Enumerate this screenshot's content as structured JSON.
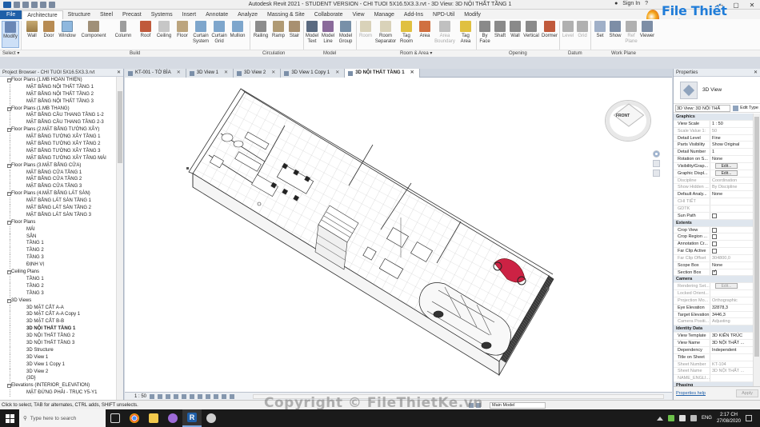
{
  "window": {
    "title": "Autodesk Revit 2021 - STUDENT VERSION - CHI TUOI 5X16.5X3.3.rvt - 3D View: 3D NỘI THẤT TẦNG 1",
    "sign_in": "Sign In",
    "help": "?"
  },
  "ribbon_tabs": [
    "File",
    "Architecture",
    "Structure",
    "Steel",
    "Precast",
    "Systems",
    "Insert",
    "Annotate",
    "Analyze",
    "Massing & Site",
    "Collaborate",
    "View",
    "Manage",
    "Add-Ins",
    "NPD-Util",
    "Modify"
  ],
  "ribbon": {
    "buttons": [
      {
        "id": "modify",
        "label": "Modify"
      },
      {
        "id": "wall",
        "label": "Wall"
      },
      {
        "id": "door",
        "label": "Door"
      },
      {
        "id": "window",
        "label": "Window"
      },
      {
        "id": "component",
        "label": "Component"
      },
      {
        "id": "column",
        "label": "Column"
      },
      {
        "id": "roof",
        "label": "Roof"
      },
      {
        "id": "ceiling",
        "label": "Ceiling"
      },
      {
        "id": "floor",
        "label": "Floor"
      },
      {
        "id": "curtain_system",
        "label": "Curtain\nSystem"
      },
      {
        "id": "curtain_grid",
        "label": "Curtain\nGrid"
      },
      {
        "id": "mullion",
        "label": "Mullion"
      },
      {
        "id": "railing",
        "label": "Railing"
      },
      {
        "id": "ramp",
        "label": "Ramp"
      },
      {
        "id": "stair",
        "label": "Stair"
      },
      {
        "id": "model_text",
        "label": "Model\nText"
      },
      {
        "id": "model_line",
        "label": "Model\nLine"
      },
      {
        "id": "model_group",
        "label": "Model\nGroup"
      },
      {
        "id": "room",
        "label": "Room"
      },
      {
        "id": "room_separator",
        "label": "Room\nSeparator"
      },
      {
        "id": "tag_room",
        "label": "Tag\nRoom"
      },
      {
        "id": "area",
        "label": "Area"
      },
      {
        "id": "area_boundary",
        "label": "Area\nBoundary"
      },
      {
        "id": "tag_area",
        "label": "Tag\nArea"
      },
      {
        "id": "by_face",
        "label": "By\nFace"
      },
      {
        "id": "shaft",
        "label": "Shaft"
      },
      {
        "id": "wall_opening",
        "label": "Wall"
      },
      {
        "id": "vertical",
        "label": "Vertical"
      },
      {
        "id": "dormer",
        "label": "Dormer"
      },
      {
        "id": "level",
        "label": "Level"
      },
      {
        "id": "grid",
        "label": "Grid"
      },
      {
        "id": "set",
        "label": "Set"
      },
      {
        "id": "show",
        "label": "Show"
      },
      {
        "id": "ref_plane",
        "label": "Ref\nPlane"
      },
      {
        "id": "viewer",
        "label": "Viewer"
      }
    ],
    "panels": [
      "Select ▾",
      "Build",
      "Circulation",
      "Model",
      "Room & Area ▾",
      "Opening",
      "Datum",
      "Work Plane"
    ]
  },
  "logo": {
    "text": "File Thiết Kế.vn"
  },
  "project_browser": {
    "title": "Project Browser - CHI TUOI 5X16.5X3.3.rvt",
    "close": "✕",
    "tree": [
      {
        "t": "g",
        "label": "Floor Plans (1.MB HOÀN THIỆN)"
      },
      {
        "t": "i",
        "label": "MẶT BẰNG NỘI THẤT TẦNG 1"
      },
      {
        "t": "i",
        "label": "MẶT BẰNG NỘI THẤT TẦNG 2"
      },
      {
        "t": "i",
        "label": "MẶT BẰNG NỘI THẤT TẦNG 3"
      },
      {
        "t": "g",
        "label": "Floor Plans (1.MB THANG)"
      },
      {
        "t": "i",
        "label": "MẶT BẰNG CẦU THANG TẦNG 1-2"
      },
      {
        "t": "i",
        "label": "MẶT BẰNG CẦU THANG TẦNG 2-3"
      },
      {
        "t": "g",
        "label": "Floor Plans (2.MẶT BẰNG TƯỜNG XÂY)"
      },
      {
        "t": "i",
        "label": "MẶT BẰNG TƯỜNG XÂY TẦNG 1"
      },
      {
        "t": "i",
        "label": "MẶT BẰNG TƯỜNG XÂY TẦNG 2"
      },
      {
        "t": "i",
        "label": "MẶT BẰNG TƯỜNG XÂY TẦNG 3"
      },
      {
        "t": "i",
        "label": "MẶT BẰNG TƯỜNG XÂY TẦNG MÁI"
      },
      {
        "t": "g",
        "label": "Floor Plans (3.MẶT BẰNG CỬA)"
      },
      {
        "t": "i",
        "label": "MẶT BẰNG CỬA TẦNG 1"
      },
      {
        "t": "i",
        "label": "MẶT BẰNG CỬA TẦNG 2"
      },
      {
        "t": "i",
        "label": "MẶT BẰNG CỬA TẦNG 3"
      },
      {
        "t": "g",
        "label": "Floor Plans (4.MẶT BẰNG LÁT SÀN)"
      },
      {
        "t": "i",
        "label": "MẶT BẰNG LÁT SÀN TẦNG 1"
      },
      {
        "t": "i",
        "label": "MẶT BẰNG LÁT SÀN TẦNG 2"
      },
      {
        "t": "i",
        "label": "MẶT BẰNG LÁT SÀN TẦNG 3"
      },
      {
        "t": "g",
        "label": "Floor Plans"
      },
      {
        "t": "i",
        "label": "MÁI"
      },
      {
        "t": "i",
        "label": "SÂN"
      },
      {
        "t": "i",
        "label": "TẦNG 1"
      },
      {
        "t": "i",
        "label": "TẦNG 2"
      },
      {
        "t": "i",
        "label": "TẦNG 3"
      },
      {
        "t": "i",
        "label": "ĐỊNH VỊ"
      },
      {
        "t": "g",
        "label": "Ceiling Plans"
      },
      {
        "t": "i",
        "label": "TẦNG 1"
      },
      {
        "t": "i",
        "label": "TẦNG 2"
      },
      {
        "t": "i",
        "label": "TẦNG 3"
      },
      {
        "t": "g",
        "label": "3D Views"
      },
      {
        "t": "i",
        "label": "3D MẶT CẮT A-A"
      },
      {
        "t": "i",
        "label": "3D MẶT CẮT A-A Copy 1"
      },
      {
        "t": "i",
        "label": "3D MẶT CẮT B-B"
      },
      {
        "t": "i",
        "label": "3D NỘI THẤT TẦNG 1",
        "sel": true
      },
      {
        "t": "i",
        "label": "3D NỘI THẤT TẦNG 2"
      },
      {
        "t": "i",
        "label": "3D NỘI THẤT TẦNG 3"
      },
      {
        "t": "i",
        "label": "3D Structure"
      },
      {
        "t": "i",
        "label": "3D View 1"
      },
      {
        "t": "i",
        "label": "3D View 1 Copy 1"
      },
      {
        "t": "i",
        "label": "3D View 2"
      },
      {
        "t": "i",
        "label": "{3D}"
      },
      {
        "t": "g",
        "label": "Elevations (INTERIOR_ELEVATION)"
      },
      {
        "t": "i",
        "label": "MẶT ĐỨNG PHẢI - TRỤC Y5-Y1"
      }
    ]
  },
  "view_tabs": [
    {
      "label": "KT-001 - TỜ BÌA"
    },
    {
      "label": "3D View 1"
    },
    {
      "label": "3D View 2"
    },
    {
      "label": "3D View 1 Copy 1"
    },
    {
      "label": "3D NỘI THẤT TẦNG 1",
      "active": true
    }
  ],
  "viewcube": {
    "face_label": "FRONT"
  },
  "view_control": {
    "scale": "1 : 50"
  },
  "properties": {
    "title": "Properties",
    "close": "✕",
    "type_name": "3D View",
    "instance_selector": "3D View: 3D NỘI THẤ",
    "edit_type": "Edit Type",
    "rows": [
      {
        "sec": "Graphics"
      },
      {
        "k": "View Scale",
        "v": "1 : 50"
      },
      {
        "k": "Scale Value    1:",
        "v": "50",
        "dim": true
      },
      {
        "k": "Detail Level",
        "v": "Fine"
      },
      {
        "k": "Parts Visibility",
        "v": "Show Original"
      },
      {
        "k": "Detail Number",
        "v": "1"
      },
      {
        "k": "Rotation on S...",
        "v": "None"
      },
      {
        "k": "Visibility/Grap...",
        "v": "Edit...",
        "btn": true
      },
      {
        "k": "Graphic Displ...",
        "v": "Edit...",
        "btn": true
      },
      {
        "k": "Discipline",
        "v": "Coordination",
        "dim": true
      },
      {
        "k": "Show Hidden ...",
        "v": "By Discipline",
        "dim": true
      },
      {
        "k": "Default Analy...",
        "v": "None"
      },
      {
        "k": "CHI TIẾT",
        "v": "",
        "dim": true
      },
      {
        "k": "GDTK",
        "v": "",
        "dim": true
      },
      {
        "k": "Sun Path",
        "v": "",
        "cb": false
      },
      {
        "sec": "Extents"
      },
      {
        "k": "Crop View",
        "v": "",
        "cb": false
      },
      {
        "k": "Crop Region ...",
        "v": "",
        "cb": false
      },
      {
        "k": "Annotation Cr...",
        "v": "",
        "cb": false
      },
      {
        "k": "Far Clip Active",
        "v": "",
        "cb": false
      },
      {
        "k": "Far Clip Offset",
        "v": "304800,0",
        "dim": true
      },
      {
        "k": "Scope Box",
        "v": "None"
      },
      {
        "k": "Section Box",
        "v": "",
        "cb": true
      },
      {
        "sec": "Camera"
      },
      {
        "k": "Rendering Set...",
        "v": "Edit...",
        "btn": true,
        "dim": true
      },
      {
        "k": "Locked Orient...",
        "v": "",
        "dim": true
      },
      {
        "k": "Projection Mo...",
        "v": "Orthographic",
        "dim": true
      },
      {
        "k": "Eye Elevation",
        "v": "32878,3"
      },
      {
        "k": "Target Elevation",
        "v": "3446,3"
      },
      {
        "k": "Camera Positi...",
        "v": "Adjusting",
        "dim": true
      },
      {
        "sec": "Identity Data"
      },
      {
        "k": "View Template",
        "v": "3D KIẾN TRÚC"
      },
      {
        "k": "View Name",
        "v": "3D NỘI THẤT ..."
      },
      {
        "k": "Dependency",
        "v": "Independent"
      },
      {
        "k": "Title on Sheet",
        "v": ""
      },
      {
        "k": "Sheet Number",
        "v": "KT-104",
        "dim": true
      },
      {
        "k": "Sheet Name",
        "v": "3D NỘI THẤT ...",
        "dim": true
      },
      {
        "k": "NAME_ENGLI...",
        "v": "",
        "dim": true
      },
      {
        "sec": "Phasing"
      }
    ],
    "help_link": "Properties help",
    "apply": "Apply"
  },
  "status": {
    "message": "Click to select, TAB for alternates, CTRL adds, SHIFT unselects.",
    "model": "Main Model",
    "zero": ":0"
  },
  "watermark": "Copyright © FileThietKe.vn",
  "taskbar": {
    "search_placeholder": "Type here to search",
    "lang": "ENG",
    "time": "2:17 CH",
    "date": "27/08/2020"
  },
  "colors": {
    "file_tab": "#1f5fa8",
    "logo_text": "#1f7cd8",
    "motorbike": "#cc2244"
  }
}
